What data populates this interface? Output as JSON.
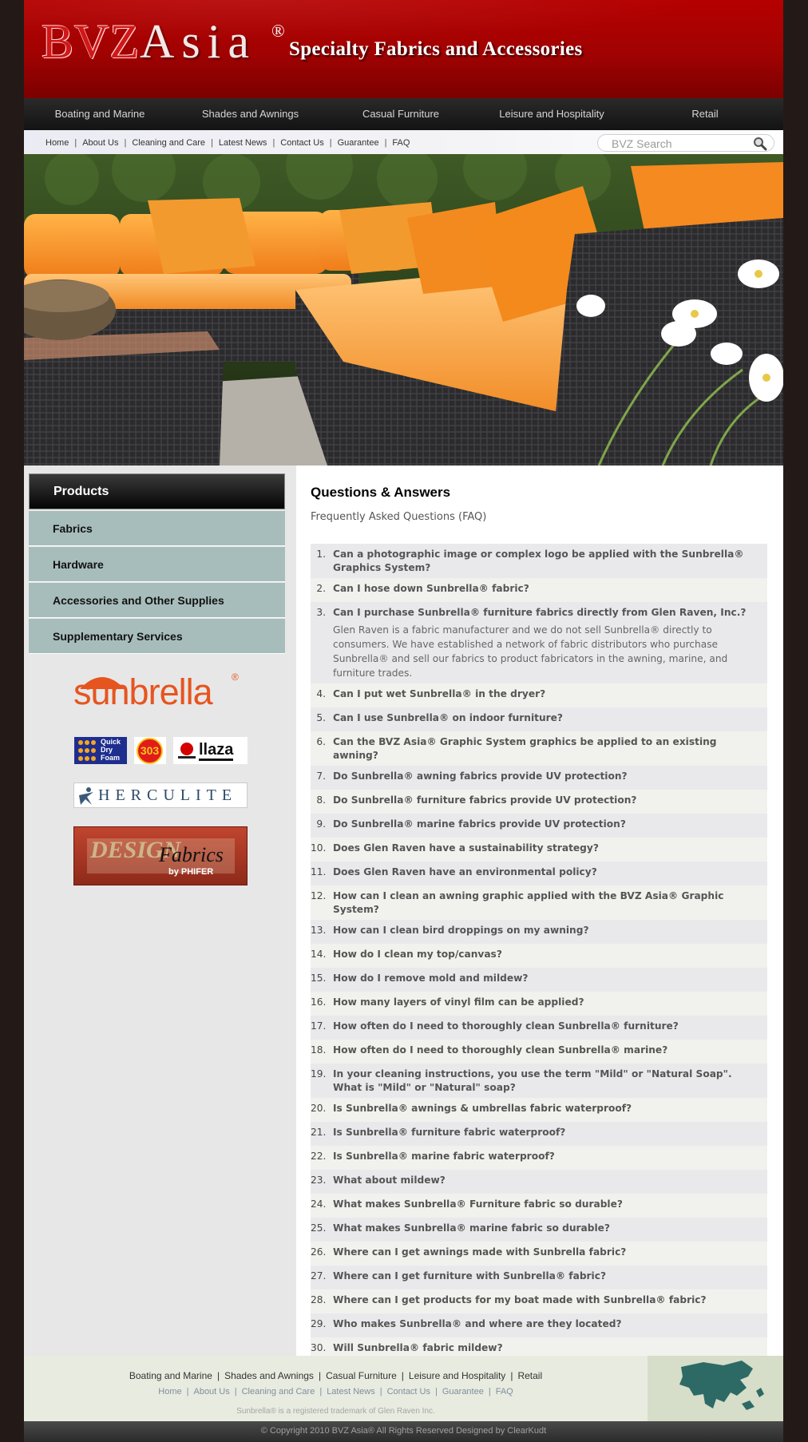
{
  "brand": {
    "logo_main": "BVZ",
    "logo_second": "Asia",
    "logo_mark": "®",
    "tagline": "Specialty Fabrics and Accessories"
  },
  "main_nav": [
    "Boating and Marine",
    "Shades and Awnings",
    "Casual Furniture",
    "Leisure and Hospitality",
    "Retail"
  ],
  "sub_nav": [
    "Home",
    "About Us",
    "Cleaning and Care",
    "Latest News",
    "Contact Us",
    "Guarantee",
    "FAQ"
  ],
  "search": {
    "placeholder": "BVZ Search"
  },
  "sidebar": {
    "heading": "Products",
    "items": [
      "Fabrics",
      "Hardware",
      "Accessories and Other Supplies",
      "Supplementary Services"
    ],
    "logos": {
      "sunbrella": "sunbrella",
      "sunbrella_mark": "®",
      "quickdry": [
        "Quick",
        "Dry",
        "Foam"
      ],
      "badge_303": "303",
      "llaza": "llaza",
      "herculite": "HERCULITE",
      "design": "DESIGN",
      "fabrics": "Fabrics",
      "phifer": "by PHIFER"
    }
  },
  "content": {
    "title": "Questions & Answers",
    "subtitle": "Frequently Asked Questions (FAQ)",
    "questions": [
      {
        "n": "1.",
        "q": "Can a photographic image or complex logo be applied with the Sunbrella® Graphics System?",
        "a": ""
      },
      {
        "n": "2.",
        "q": "Can I hose down Sunbrella® fabric?",
        "a": ""
      },
      {
        "n": "3.",
        "q": "Can I purchase Sunbrella® furniture fabrics directly from Glen Raven, Inc.?",
        "a": "Glen Raven is a fabric manufacturer and we do not sell Sunbrella® directly to consumers. We have established a network of fabric distributors who purchase Sunbrella® and sell our fabrics to product fabricators in the awning, marine, and furniture trades."
      },
      {
        "n": "4.",
        "q": "Can I put wet Sunbrella® in the dryer?",
        "a": ""
      },
      {
        "n": "5.",
        "q": "Can I use Sunbrella® on indoor furniture?",
        "a": ""
      },
      {
        "n": "6.",
        "q": "Can the BVZ Asia® Graphic System graphics be applied to an existing awning?",
        "a": ""
      },
      {
        "n": "7.",
        "q": "Do Sunbrella® awning fabrics provide UV protection?",
        "a": ""
      },
      {
        "n": "8.",
        "q": "Do Sunbrella® furniture fabrics provide UV protection?",
        "a": ""
      },
      {
        "n": "9.",
        "q": "Do Sunbrella® marine fabrics provide UV protection?",
        "a": ""
      },
      {
        "n": "10.",
        "q": "Does Glen Raven have a sustainability strategy?",
        "a": ""
      },
      {
        "n": "11.",
        "q": "Does Glen Raven have an environmental policy?",
        "a": ""
      },
      {
        "n": "12.",
        "q": "How can I clean an awning graphic applied with the BVZ Asia® Graphic System?",
        "a": ""
      },
      {
        "n": "13.",
        "q": "How can I clean bird droppings on my awning?",
        "a": ""
      },
      {
        "n": "14.",
        "q": "How do I clean my top/canvas?",
        "a": ""
      },
      {
        "n": "15.",
        "q": "How do I remove mold and mildew?",
        "a": ""
      },
      {
        "n": "16.",
        "q": "How many layers of vinyl film can be applied?",
        "a": ""
      },
      {
        "n": "17.",
        "q": "How often do I need to thoroughly clean Sunbrella® furniture?",
        "a": ""
      },
      {
        "n": "18.",
        "q": "How often do I need to thoroughly clean Sunbrella® marine?",
        "a": ""
      },
      {
        "n": "19.",
        "q": "In your cleaning instructions, you use the term \"Mild\" or \"Natural Soap\". What is \"Mild\" or \"Natural\" soap?",
        "a": ""
      },
      {
        "n": "20.",
        "q": "Is Sunbrella® awnings & umbrellas fabric waterproof?",
        "a": ""
      },
      {
        "n": "21.",
        "q": "Is Sunbrella® furniture fabric waterproof?",
        "a": ""
      },
      {
        "n": "22.",
        "q": "Is Sunbrella® marine fabric waterproof?",
        "a": ""
      },
      {
        "n": "23.",
        "q": "What about mildew?",
        "a": ""
      },
      {
        "n": "24.",
        "q": "What makes Sunbrella® Furniture fabric so durable?",
        "a": ""
      },
      {
        "n": "25.",
        "q": "What makes Sunbrella® marine fabric so durable?",
        "a": ""
      },
      {
        "n": "26.",
        "q": "Where can I get awnings made with Sunbrella fabric?",
        "a": ""
      },
      {
        "n": "27.",
        "q": "Where can I get furniture with Sunbrella® fabric?",
        "a": ""
      },
      {
        "n": "28.",
        "q": "Where can I get products for my boat made with Sunbrella® fabric?",
        "a": ""
      },
      {
        "n": "29.",
        "q": "Who makes Sunbrella® and where are they located?",
        "a": ""
      },
      {
        "n": "30.",
        "q": "Will Sunbrella® fabric mildew?",
        "a": ""
      }
    ]
  },
  "footer": {
    "main_links": [
      "Boating and Marine",
      "Shades and Awnings",
      "Casual Furniture",
      "Leisure and Hospitality",
      "Retail"
    ],
    "sub_links": [
      "Home",
      "About Us",
      "Cleaning and Care",
      "Latest News",
      "Contact Us",
      "Guarantee",
      "FAQ"
    ],
    "trademark": "Sunbrella® is a registered trademark of Glen Raven Inc.",
    "copyright": "© Copyright 2010 BVZ Asia® All Rights Reserved Designed by ClearKudt"
  },
  "colors": {
    "header_red": "#a10202",
    "sidebar_item": "#a7bdbb",
    "frame_dark": "#231a18"
  }
}
